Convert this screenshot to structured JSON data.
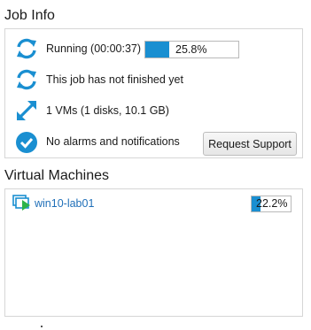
{
  "job_info": {
    "title": "Job Info",
    "status_text": "Running (00:00:37)",
    "progress": {
      "percent": 25.8,
      "label": "25.8%"
    },
    "finished_text": "This job has not finished yet",
    "vms_text": "1 VMs (1 disks, 10.1 GB)",
    "alarms_text": "No alarms and notifications",
    "request_support_label": "Request Support",
    "icons": {
      "status": "sync-icon",
      "finished": "sync-icon",
      "vms": "expand-icon",
      "alarms": "check-circle-icon"
    }
  },
  "virtual_machines": {
    "title": "Virtual Machines",
    "items": [
      {
        "name": "win10-lab01",
        "icon": "vm-running-icon",
        "progress": {
          "percent": 22.2,
          "label": "22.2%"
        }
      }
    ]
  },
  "colors": {
    "accent": "#1a8fd1",
    "link": "#1f6fb8",
    "running_green": "#2db34a"
  }
}
